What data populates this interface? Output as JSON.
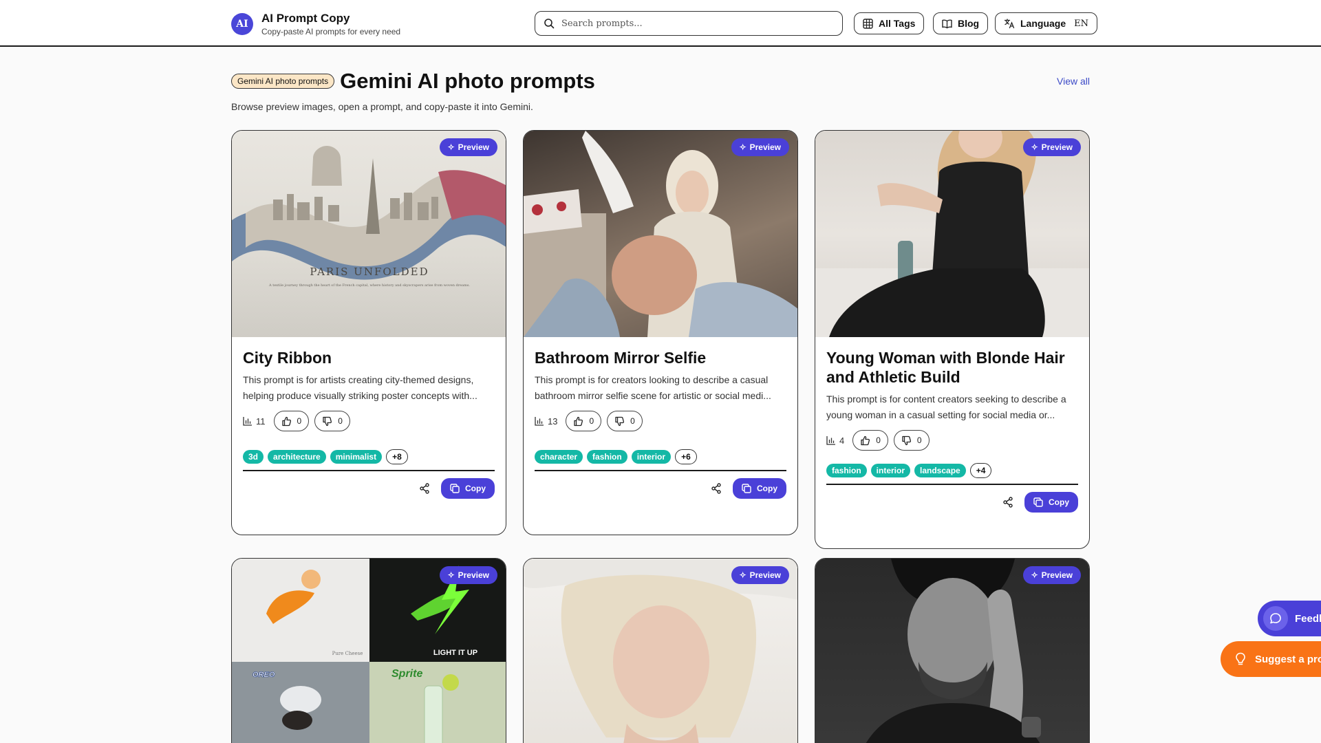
{
  "header": {
    "logo_text": "AI",
    "title": "AI Prompt Copy",
    "subtitle": "Copy-paste AI prompts for every need",
    "search_placeholder": "Search prompts...",
    "all_tags": "All Tags",
    "blog": "Blog",
    "language": "Language",
    "language_code": "EN"
  },
  "section": {
    "chip": "Gemini AI photo prompts",
    "title": "Gemini AI photo prompts",
    "view_all": "View all",
    "description": "Browse preview images, open a prompt, and copy-paste it into Gemini."
  },
  "preview_label": "Preview",
  "copy_label": "Copy",
  "cards": [
    {
      "title": "City Ribbon",
      "description": "This prompt is for artists creating city-themed designs, helping produce visually striking poster concepts with...",
      "views": "11",
      "likes": "0",
      "dislikes": "0",
      "tags": [
        "3d",
        "architecture",
        "minimalist"
      ],
      "more": "+8",
      "image_title": "PARIS UNFOLDED",
      "image_caption": "A textile journey through the heart of the French capital, where history and skyscrapers arise from woven dreams."
    },
    {
      "title": "Bathroom Mirror Selfie",
      "description": "This prompt is for creators looking to describe a casual bathroom mirror selfie scene for artistic or social medi...",
      "views": "13",
      "likes": "0",
      "dislikes": "0",
      "tags": [
        "character",
        "fashion",
        "interior"
      ],
      "more": "+6"
    },
    {
      "title": "Young Woman with Blonde Hair and Athletic Build",
      "description": "This prompt is for content creators seeking to describe a young woman in a casual setting for social media or...",
      "views": "4",
      "likes": "0",
      "dislikes": "0",
      "tags": [
        "fashion",
        "interior",
        "landscape"
      ],
      "more": "+4"
    },
    {
      "image_texts": [
        "Pure Cheese",
        "LIGHT IT UP",
        "OREO",
        "Sprite"
      ]
    },
    {},
    {}
  ],
  "floating": {
    "feedback": "Feedb",
    "suggest": "Suggest a pro"
  },
  "colors": {
    "accent": "#4a40d8",
    "tag": "#14b8a6",
    "chip": "#fbe6c6",
    "link": "#3b49c7",
    "suggest": "#f97316"
  }
}
